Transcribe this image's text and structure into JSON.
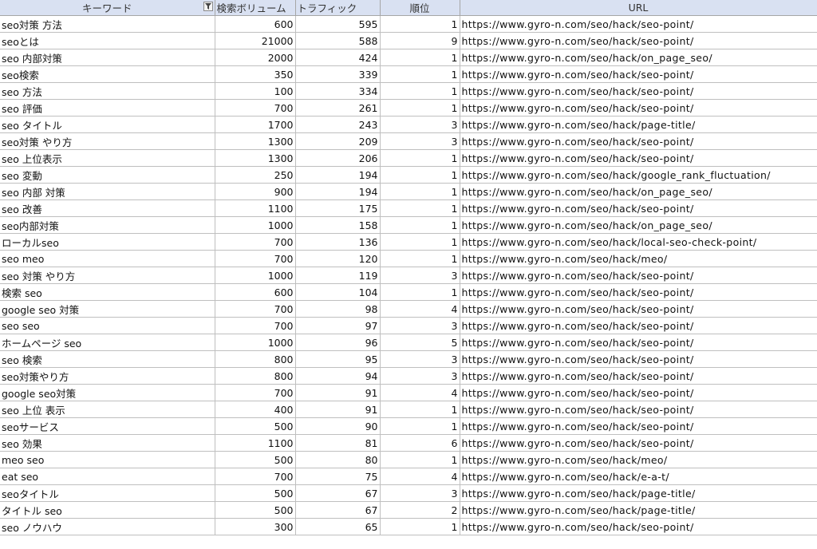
{
  "headers": {
    "keyword": "キーワード",
    "volume": "検索ボリューム",
    "traffic": "トラフィック",
    "rank": "順位",
    "url": "URL"
  },
  "rows": [
    [
      "seo対策 方法",
      "600",
      "595",
      "1",
      "https://www.gyro-n.com/seo/hack/seo-point/"
    ],
    [
      "seoとは",
      "21000",
      "588",
      "9",
      "https://www.gyro-n.com/seo/hack/seo-point/"
    ],
    [
      "seo 内部対策",
      "2000",
      "424",
      "1",
      "https://www.gyro-n.com/seo/hack/on_page_seo/"
    ],
    [
      "seo検索",
      "350",
      "339",
      "1",
      "https://www.gyro-n.com/seo/hack/seo-point/"
    ],
    [
      "seo 方法",
      "100",
      "334",
      "1",
      "https://www.gyro-n.com/seo/hack/seo-point/"
    ],
    [
      "seo 評価",
      "700",
      "261",
      "1",
      "https://www.gyro-n.com/seo/hack/seo-point/"
    ],
    [
      "seo タイトル",
      "1700",
      "243",
      "3",
      "https://www.gyro-n.com/seo/hack/page-title/"
    ],
    [
      "seo対策 やり方",
      "1300",
      "209",
      "3",
      "https://www.gyro-n.com/seo/hack/seo-point/"
    ],
    [
      "seo 上位表示",
      "1300",
      "206",
      "1",
      "https://www.gyro-n.com/seo/hack/seo-point/"
    ],
    [
      "seo 変動",
      "250",
      "194",
      "1",
      "https://www.gyro-n.com/seo/hack/google_rank_fluctuation/"
    ],
    [
      "seo 内部 対策",
      "900",
      "194",
      "1",
      "https://www.gyro-n.com/seo/hack/on_page_seo/"
    ],
    [
      "seo 改善",
      "1100",
      "175",
      "1",
      "https://www.gyro-n.com/seo/hack/seo-point/"
    ],
    [
      "seo内部対策",
      "1000",
      "158",
      "1",
      "https://www.gyro-n.com/seo/hack/on_page_seo/"
    ],
    [
      "ローカルseo",
      "700",
      "136",
      "1",
      "https://www.gyro-n.com/seo/hack/local-seo-check-point/"
    ],
    [
      "seo meo",
      "700",
      "120",
      "1",
      "https://www.gyro-n.com/seo/hack/meo/"
    ],
    [
      "seo 対策 やり方",
      "1000",
      "119",
      "3",
      "https://www.gyro-n.com/seo/hack/seo-point/"
    ],
    [
      "検索 seo",
      "600",
      "104",
      "1",
      "https://www.gyro-n.com/seo/hack/seo-point/"
    ],
    [
      "google seo 対策",
      "700",
      "98",
      "4",
      "https://www.gyro-n.com/seo/hack/seo-point/"
    ],
    [
      "seo seo",
      "700",
      "97",
      "3",
      "https://www.gyro-n.com/seo/hack/seo-point/"
    ],
    [
      "ホームページ seo",
      "1000",
      "96",
      "5",
      "https://www.gyro-n.com/seo/hack/seo-point/"
    ],
    [
      "seo 検索",
      "800",
      "95",
      "3",
      "https://www.gyro-n.com/seo/hack/seo-point/"
    ],
    [
      "seo対策やり方",
      "800",
      "94",
      "3",
      "https://www.gyro-n.com/seo/hack/seo-point/"
    ],
    [
      "google seo対策",
      "700",
      "91",
      "4",
      "https://www.gyro-n.com/seo/hack/seo-point/"
    ],
    [
      "seo 上位 表示",
      "400",
      "91",
      "1",
      "https://www.gyro-n.com/seo/hack/seo-point/"
    ],
    [
      "seoサービス",
      "500",
      "90",
      "1",
      "https://www.gyro-n.com/seo/hack/seo-point/"
    ],
    [
      "seo 効果",
      "1100",
      "81",
      "6",
      "https://www.gyro-n.com/seo/hack/seo-point/"
    ],
    [
      "meo seo",
      "500",
      "80",
      "1",
      "https://www.gyro-n.com/seo/hack/meo/"
    ],
    [
      "eat seo",
      "700",
      "75",
      "4",
      "https://www.gyro-n.com/seo/hack/e-a-t/"
    ],
    [
      "seoタイトル",
      "500",
      "67",
      "3",
      "https://www.gyro-n.com/seo/hack/page-title/"
    ],
    [
      "タイトル seo",
      "500",
      "67",
      "2",
      "https://www.gyro-n.com/seo/hack/page-title/"
    ],
    [
      "seo ノウハウ",
      "300",
      "65",
      "1",
      "https://www.gyro-n.com/seo/hack/seo-point/"
    ]
  ]
}
